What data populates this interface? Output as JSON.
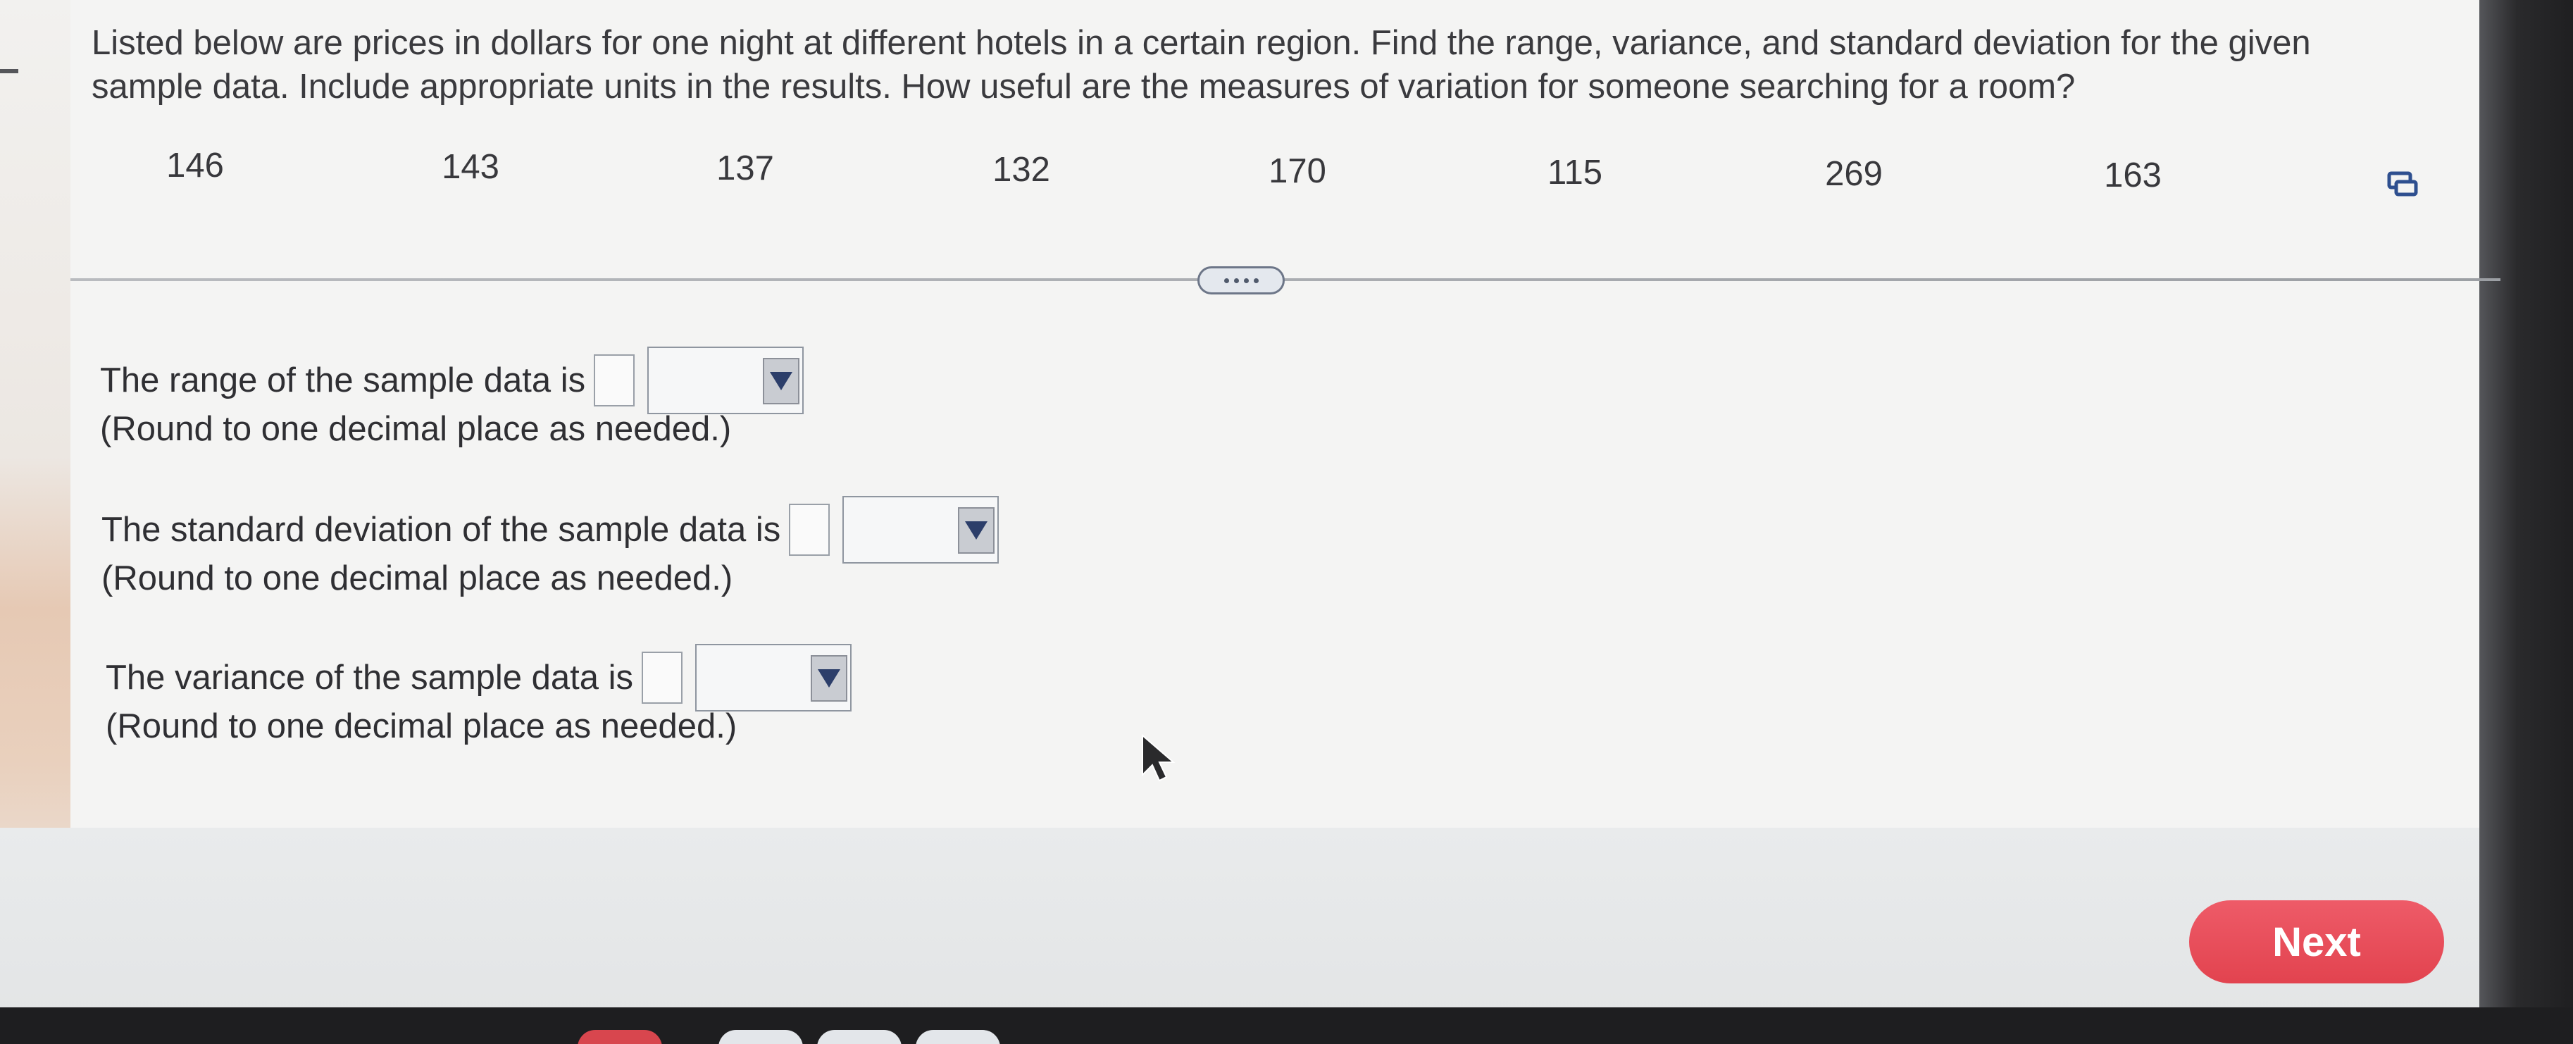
{
  "question": {
    "text": "Listed below are prices in dollars for one night at different hotels in a certain region. Find the range, variance, and standard deviation for the given sample data. Include appropriate units in the results. How useful are the measures of variation for someone searching for a room?"
  },
  "data_values": [
    "146",
    "143",
    "137",
    "132",
    "170",
    "115",
    "269",
    "163"
  ],
  "answers": [
    {
      "prompt": "The range of the sample data is",
      "hint": "(Round to one decimal place as needed.)",
      "value": "",
      "unit": ""
    },
    {
      "prompt": "The standard deviation of the sample data is",
      "hint": "(Round to one decimal place as needed.)",
      "value": "",
      "unit": ""
    },
    {
      "prompt": "The variance of the sample data is",
      "hint": "(Round to one decimal place as needed.)",
      "value": "",
      "unit": ""
    }
  ],
  "navigation": {
    "next_label": "Next"
  },
  "colors": {
    "next_button": "#e64b57",
    "panel": "#f4f4f3",
    "select_arrow": "#2c3e6a"
  },
  "icons": {
    "copy": "copy-data-icon",
    "more": "more-dots-icon",
    "cursor": "mouse-pointer-icon"
  }
}
